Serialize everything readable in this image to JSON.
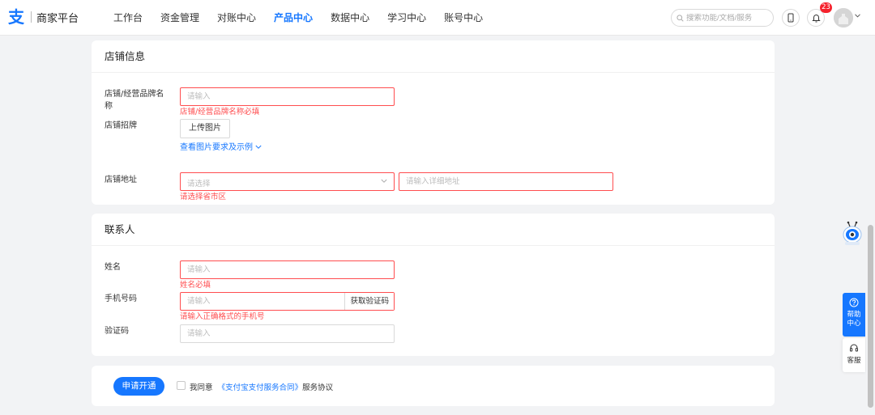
{
  "header": {
    "logo_mark": "支",
    "logo_text": "商家平台",
    "nav": [
      "工作台",
      "资金管理",
      "对账中心",
      "产品中心",
      "数据中心",
      "学习中心",
      "账号中心"
    ],
    "active_nav": "产品中心",
    "search_placeholder": "搜索功能/文档/服务",
    "notification_count": "23"
  },
  "store_info": {
    "title": "店铺信息",
    "name_label_line1": "店铺/经营品牌名",
    "name_label_line2": "称",
    "name_placeholder": "请输入",
    "name_error": "店铺/经营品牌名称必填",
    "sign_label": "店铺招牌",
    "upload_button": "上传图片",
    "view_requirements": "查看图片要求及示例",
    "address_label": "店铺地址",
    "region_placeholder": "请选择",
    "address_placeholder": "请输入详细地址",
    "region_error": "请选择省市区"
  },
  "contact": {
    "title": "联系人",
    "name_label": "姓名",
    "name_placeholder": "请输入",
    "name_error": "姓名必填",
    "phone_label": "手机号码",
    "phone_placeholder": "请输入",
    "get_code_button": "获取验证码",
    "phone_error": "请输入正确格式的手机号",
    "code_label": "验证码",
    "code_placeholder": "请输入"
  },
  "footer": {
    "submit_button": "申请开通",
    "agree_prefix": "我同意",
    "agreement_link": "《支付宝支付服务合同》",
    "agree_suffix": "服务协议"
  },
  "side": {
    "help_line1": "帮助",
    "help_line2": "中心",
    "service": "客服"
  },
  "colors": {
    "primary": "#1677ff",
    "error": "#ff4d4f",
    "badge": "#f5222d"
  }
}
